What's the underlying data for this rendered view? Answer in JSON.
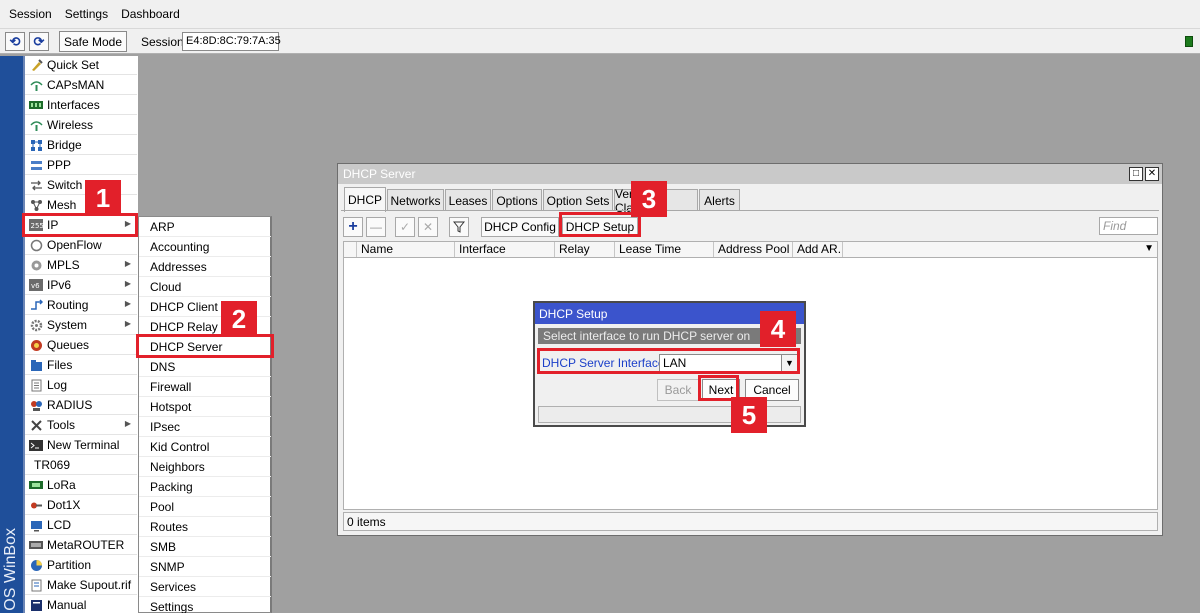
{
  "menubar": [
    "Session",
    "Settings",
    "Dashboard"
  ],
  "toolbar": {
    "undo_icon": "undo-icon",
    "redo_icon": "redo-icon",
    "safe_mode": "Safe Mode",
    "session_label": "Session:",
    "session_value": "E4:8D:8C:79:7A:35",
    "status_color": "#1c7a1c"
  },
  "branding": {
    "vertical_text": "OS WinBox"
  },
  "sidebar": {
    "items": [
      {
        "label": "Quick Set",
        "icon": "quickset-icon",
        "arrow": false
      },
      {
        "label": "CAPsMAN",
        "icon": "capsman-icon",
        "arrow": false
      },
      {
        "label": "Interfaces",
        "icon": "interfaces-icon",
        "arrow": false
      },
      {
        "label": "Wireless",
        "icon": "wireless-icon",
        "arrow": false
      },
      {
        "label": "Bridge",
        "icon": "bridge-icon",
        "arrow": false
      },
      {
        "label": "PPP",
        "icon": "ppp-icon",
        "arrow": false
      },
      {
        "label": "Switch",
        "icon": "switch-icon",
        "arrow": false
      },
      {
        "label": "Mesh",
        "icon": "mesh-icon",
        "arrow": false
      },
      {
        "label": "IP",
        "icon": "ip-icon",
        "arrow": true
      },
      {
        "label": "OpenFlow",
        "icon": "openflow-icon",
        "arrow": false
      },
      {
        "label": "MPLS",
        "icon": "mpls-icon",
        "arrow": true
      },
      {
        "label": "IPv6",
        "icon": "ipv6-icon",
        "arrow": true
      },
      {
        "label": "Routing",
        "icon": "routing-icon",
        "arrow": true
      },
      {
        "label": "System",
        "icon": "system-icon",
        "arrow": true
      },
      {
        "label": "Queues",
        "icon": "queues-icon",
        "arrow": false
      },
      {
        "label": "Files",
        "icon": "files-icon",
        "arrow": false
      },
      {
        "label": "Log",
        "icon": "log-icon",
        "arrow": false
      },
      {
        "label": "RADIUS",
        "icon": "radius-icon",
        "arrow": false
      },
      {
        "label": "Tools",
        "icon": "tools-icon",
        "arrow": true
      },
      {
        "label": "New Terminal",
        "icon": "terminal-icon",
        "arrow": false
      },
      {
        "label": "TR069",
        "icon": "",
        "arrow": false
      },
      {
        "label": "LoRa",
        "icon": "lora-icon",
        "arrow": false
      },
      {
        "label": "Dot1X",
        "icon": "dot1x-icon",
        "arrow": false
      },
      {
        "label": "LCD",
        "icon": "lcd-icon",
        "arrow": false
      },
      {
        "label": "MetaROUTER",
        "icon": "metarouter-icon",
        "arrow": false
      },
      {
        "label": "Partition",
        "icon": "partition-icon",
        "arrow": false
      },
      {
        "label": "Make Supout.rif",
        "icon": "supout-icon",
        "arrow": false
      },
      {
        "label": "Manual",
        "icon": "manual-icon",
        "arrow": false
      }
    ]
  },
  "submenu": {
    "items": [
      "ARP",
      "Accounting",
      "Addresses",
      "Cloud",
      "DHCP Client",
      "DHCP Relay",
      "DHCP Server",
      "DNS",
      "Firewall",
      "Hotspot",
      "IPsec",
      "Kid Control",
      "Neighbors",
      "Packing",
      "Pool",
      "Routes",
      "SMB",
      "SNMP",
      "Services",
      "Settings"
    ]
  },
  "dhcp_window": {
    "title": "DHCP Server",
    "tabs": [
      "DHCP",
      "Networks",
      "Leases",
      "Options",
      "Option Sets",
      "Vendor Classes",
      "Alerts"
    ],
    "active_tab": "DHCP",
    "buttons": {
      "config": "DHCP Config",
      "setup": "DHCP Setup"
    },
    "find_placeholder": "Find",
    "columns": [
      "Name",
      "Interface",
      "Relay",
      "Lease Time",
      "Address Pool",
      "Add AR..."
    ],
    "status": "0 items"
  },
  "dialog": {
    "title": "DHCP Setup",
    "subtitle": "Select interface to run DHCP server on",
    "field_label": "DHCP Server Interface:",
    "field_value": "LAN",
    "back": "Back",
    "next": "Next",
    "cancel": "Cancel"
  },
  "annotations": {
    "steps": [
      "1",
      "2",
      "3",
      "4",
      "5"
    ],
    "color": "#e2202a"
  }
}
